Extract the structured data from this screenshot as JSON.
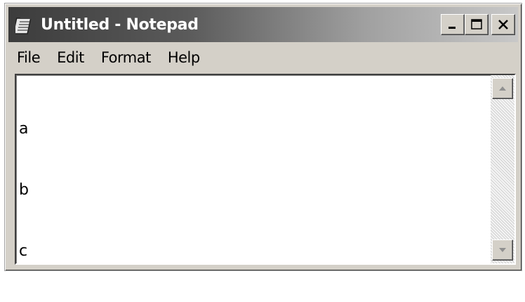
{
  "window": {
    "title": "Untitled - Notepad",
    "icon": "notepad-icon"
  },
  "title_buttons": {
    "minimize_icon": "minimize-icon",
    "maximize_icon": "maximize-icon",
    "close_icon": "close-icon"
  },
  "menu": {
    "items": [
      {
        "label": "File"
      },
      {
        "label": "Edit"
      },
      {
        "label": "Format"
      },
      {
        "label": "Help"
      }
    ]
  },
  "editor": {
    "lines": [
      "a",
      "b",
      "c"
    ]
  },
  "scrollbar": {
    "up_icon": "scroll-up-arrow-icon",
    "down_icon": "scroll-down-arrow-icon"
  },
  "colors": {
    "title_gradient_start": "#3c3c3c",
    "title_gradient_end": "#c8c8c8",
    "window_face": "#d4d0c8"
  }
}
